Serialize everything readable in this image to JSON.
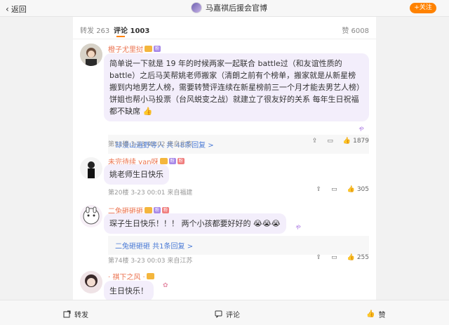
{
  "topbar": {
    "back_label": "返回",
    "title": "马嘉祺后援会官博",
    "follow_label": "+关注"
  },
  "tabs": {
    "repost_label": "转发",
    "repost_count": "263",
    "comment_label": "评论",
    "comment_count": "1003",
    "like_label": "赞",
    "like_count": "6008"
  },
  "comments": [
    {
      "name": "橙子尤里挝",
      "text": "简单说一下就是 19 年的时候两家一起联合 battle过（和友谊性质的battle）之后马芙帮姚老师搬家（清朗之前有个榜单，搬家就是从新星榜搬到内地男艺人榜，需要转赞评连续在新星榜前三一个月才能去男艺人榜）饼姐也帮小马投票（台风蜕变之战）就建立了很友好的关系 每年生日祝福都不缺席 👍",
      "reply": "却漫山遍野等人  共 48条回复 >",
      "meta": "第51楼  3-23 00:02  来自北京",
      "likes": "1879"
    },
    {
      "name": "未完待续 yan呀",
      "text": "姚老师生日快乐",
      "meta": "第20楼  3-23 00:01  来自福建",
      "likes": "305"
    },
    {
      "name": "二兔砸砸砸",
      "text": "琛子生日快乐！！！ 两个小孩都要好好的 😭😭😭",
      "reply": "二兔砸砸砸  共1条回复 >",
      "meta": "第74楼  3-23 00:03  来自江苏",
      "likes": "255"
    },
    {
      "name": "· 祺下之风 ·",
      "text": "生日快乐！"
    }
  ],
  "bottombar": {
    "repost_label": "转发",
    "comment_label": "评论",
    "like_label": "赞"
  },
  "colors": {
    "accent": "#ff8200",
    "name": "#eb7350",
    "link": "#4b7bd6",
    "bubble": "#f3eefb"
  }
}
